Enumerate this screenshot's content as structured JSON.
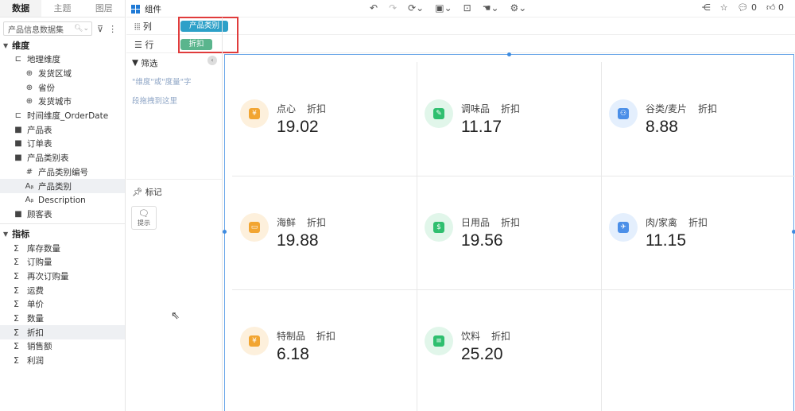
{
  "left_panel": {
    "tabs": [
      "数据",
      "主题",
      "图层"
    ],
    "search_value": "产品信息数据集",
    "dimension_title": "维度",
    "dimensions": [
      {
        "label": "地理维度",
        "icon": "hierarchy-icon",
        "level": 1
      },
      {
        "label": "发货区域",
        "icon": "globe-icon",
        "level": 2
      },
      {
        "label": "省份",
        "icon": "globe-icon",
        "level": 2
      },
      {
        "label": "发货城市",
        "icon": "globe-icon",
        "level": 2
      },
      {
        "label": "时间维度_OrderDate",
        "icon": "hierarchy-icon",
        "level": 1
      },
      {
        "label": "产品表",
        "icon": "folder-icon",
        "level": 1
      },
      {
        "label": "订单表",
        "icon": "folder-icon",
        "level": 1
      },
      {
        "label": "产品类别表",
        "icon": "folder-icon",
        "level": 1
      },
      {
        "label": "产品类别编号",
        "icon": "number-field-icon",
        "level": 2
      },
      {
        "label": "产品类别",
        "icon": "text-field-icon",
        "level": 2,
        "selected": true
      },
      {
        "label": "Description",
        "icon": "text-field-icon",
        "level": 2
      },
      {
        "label": "顾客表",
        "icon": "folder-icon",
        "level": 1
      }
    ],
    "metric_title": "指标",
    "metrics": [
      {
        "label": "库存数量"
      },
      {
        "label": "订购量"
      },
      {
        "label": "再次订购量"
      },
      {
        "label": "运费"
      },
      {
        "label": "单价"
      },
      {
        "label": "数量"
      },
      {
        "label": "折扣",
        "selected": true
      },
      {
        "label": "销售额"
      },
      {
        "label": "利润"
      }
    ]
  },
  "middle_panel": {
    "filter_title": "筛选",
    "filter_hint_1": "\"维度\"或\"度量\"字",
    "filter_hint_2": "段拖拽到这里",
    "mark_title": "标记",
    "tooltip_button": "提示"
  },
  "topbar": {
    "component_label": "组件",
    "comment_count": "0",
    "like_count": "0"
  },
  "shelves": {
    "column_label": "列",
    "row_label": "行",
    "column_pill": "产品类别",
    "row_pill": "折扣"
  },
  "kpi_cards": [
    {
      "category": "点心",
      "measure": "折扣",
      "value": "19.02",
      "icon": "coin-icon",
      "bg": "#fdf0dc",
      "fg": "#f2a531"
    },
    {
      "category": "调味品",
      "measure": "折扣",
      "value": "11.17",
      "icon": "money-hand-icon",
      "bg": "#e1f6ea",
      "fg": "#2fbf6f"
    },
    {
      "category": "谷类/麦片",
      "measure": "折扣",
      "value": "8.88",
      "icon": "users-icon",
      "bg": "#e4effd",
      "fg": "#4b8fe8"
    },
    {
      "category": "海鲜",
      "measure": "折扣",
      "value": "19.88",
      "icon": "wallet-icon",
      "bg": "#fdf0dc",
      "fg": "#f2a531"
    },
    {
      "category": "日用品",
      "measure": "折扣",
      "value": "19.56",
      "icon": "money-bag-icon",
      "bg": "#e1f6ea",
      "fg": "#2fbf6f"
    },
    {
      "category": "肉/家禽",
      "measure": "折扣",
      "value": "11.15",
      "icon": "plane-globe-icon",
      "bg": "#e4effd",
      "fg": "#4b8fe8"
    },
    {
      "category": "特制品",
      "measure": "折扣",
      "value": "6.18",
      "icon": "coin-hand-icon",
      "bg": "#fdf0dc",
      "fg": "#f2a531"
    },
    {
      "category": "饮料",
      "measure": "折扣",
      "value": "25.20",
      "icon": "document-icon",
      "bg": "#e1f6ea",
      "fg": "#2fbf6f"
    }
  ]
}
